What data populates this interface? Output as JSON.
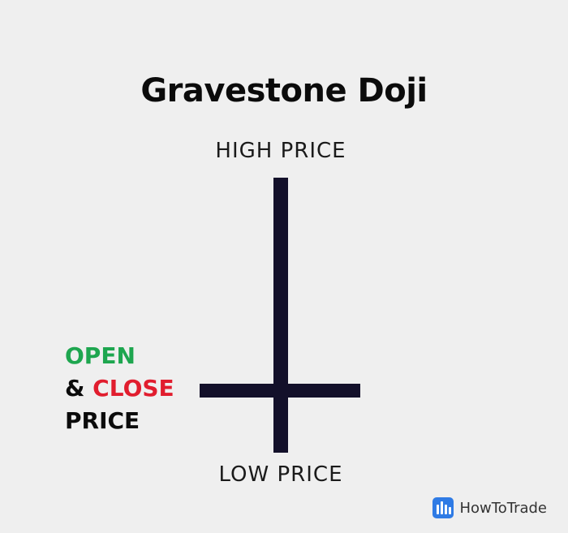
{
  "diagram": {
    "title": "Gravestone Doji",
    "high_label": "HIGH PRICE",
    "low_label": "LOW PRICE",
    "open_close_label": {
      "line1": "OPEN",
      "line2_prefix": "&",
      "line2_close": "CLOSE",
      "line3": "PRICE"
    },
    "colors": {
      "background": "#efefef",
      "candle": "#13102a",
      "open": "#1ea64f",
      "close": "#e11d2e",
      "logo": "#2f7be5"
    }
  },
  "branding": {
    "logo_text": "HowToTrade",
    "logo_icon": "bar-chart-icon"
  }
}
